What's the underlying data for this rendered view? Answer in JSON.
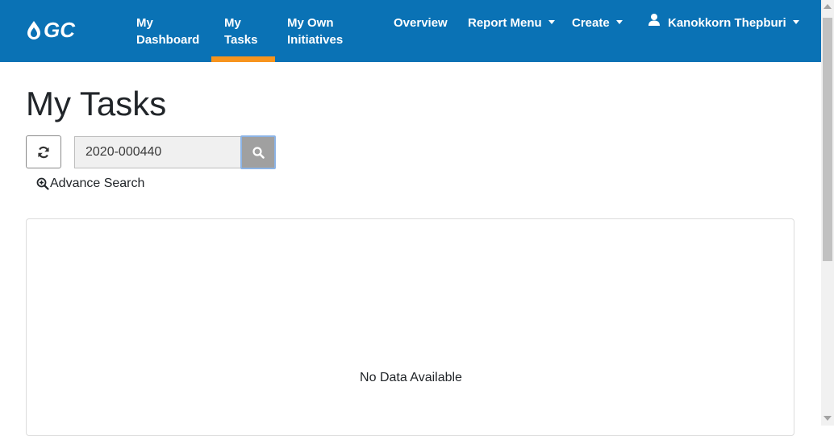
{
  "nav": {
    "logo_text": "GC",
    "items": [
      {
        "line1": "My",
        "line2": "Dashboard"
      },
      {
        "line1": "My",
        "line2": "Tasks"
      },
      {
        "line1": "My Own",
        "line2": "Initiatives"
      }
    ],
    "overview": "Overview",
    "report_menu": "Report Menu",
    "create": "Create",
    "user_name": "Kanokkorn Thepburi",
    "active_item": "My Tasks",
    "brand_color": "#0a72b5",
    "active_color": "#f7941d"
  },
  "page": {
    "title": "My Tasks"
  },
  "search": {
    "value": "2020-000440",
    "refresh_icon": "refresh-icon",
    "search_icon": "search-icon",
    "advance_search_label": "Advance Search",
    "advance_search_icon": "zoom-plus-icon"
  },
  "results": {
    "empty_message": "No Data Available"
  }
}
